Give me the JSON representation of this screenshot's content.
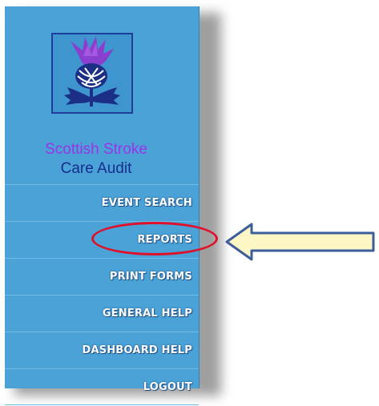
{
  "brand": {
    "line1": "Scottish Stroke",
    "line2": "Care Audit",
    "logo_icon": "thistle-icon",
    "line1_color": "#9a34e8",
    "line2_color": "#162d8c"
  },
  "menu": {
    "items": [
      {
        "label": "EVENT SEARCH"
      },
      {
        "label": "REPORTS"
      },
      {
        "label": "PRINT FORMS"
      },
      {
        "label": "GENERAL HELP"
      },
      {
        "label": "DASHBOARD HELP"
      },
      {
        "label": "LOGOUT"
      }
    ]
  },
  "annotation": {
    "highlighted_item": "REPORTS",
    "ellipse_color": "#e0102a",
    "arrow_fill": "#fdf6c5",
    "arrow_outline": "#3d5e9b",
    "arrow_icon": "left-arrow-icon"
  },
  "colors": {
    "sidebar_bg": "#4aa2d6",
    "logo_border": "#1d3f9a"
  }
}
